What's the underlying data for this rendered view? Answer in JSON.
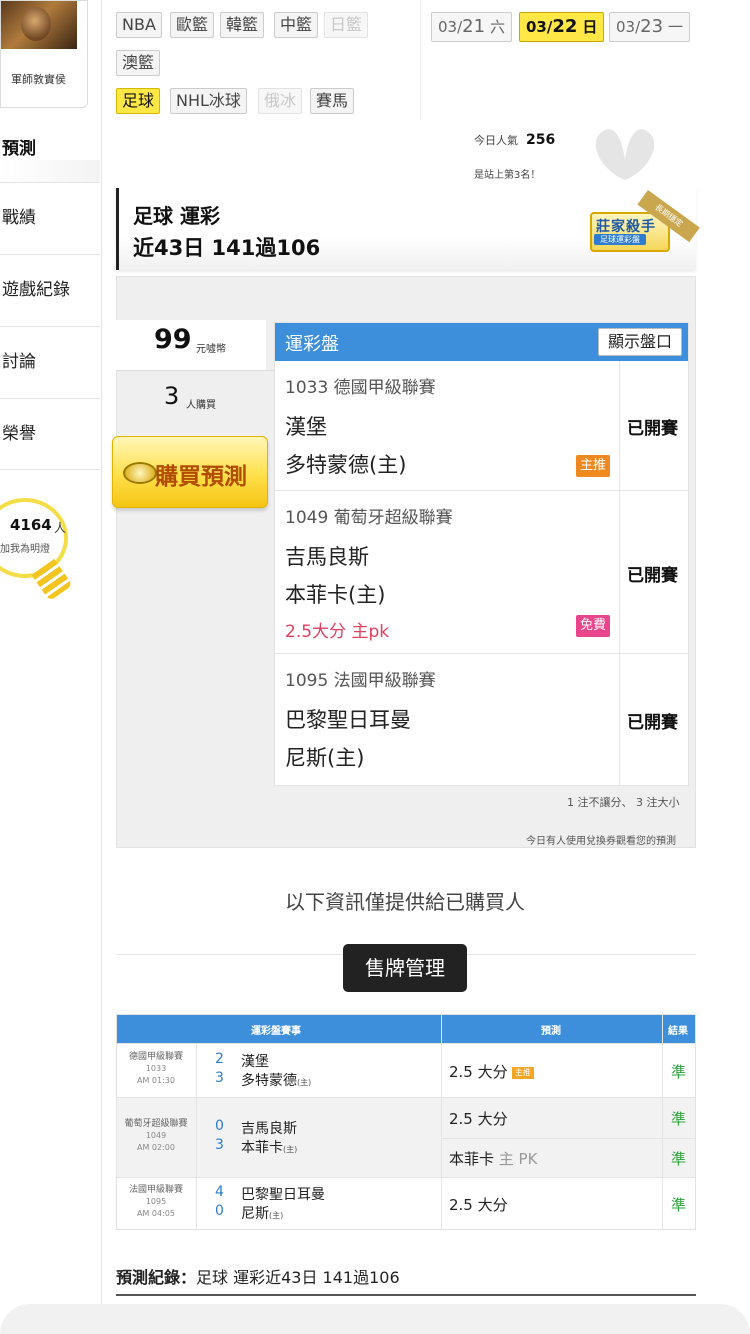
{
  "profile": {
    "name": "軍師敦實侯"
  },
  "left_nav": {
    "section_title": "預測",
    "items": [
      "戰績",
      "遊戲紀錄",
      "討論",
      "榮譽"
    ],
    "fans": {
      "count": "4164",
      "unit": "人",
      "join": "加我為明燈"
    }
  },
  "categories": [
    {
      "label": "NBA",
      "state": "normal"
    },
    {
      "label": "歐籃",
      "state": "normal"
    },
    {
      "label": "韓籃",
      "state": "normal"
    },
    {
      "label": "中籃",
      "state": "normal"
    },
    {
      "label": "日籃",
      "state": "disabled"
    },
    {
      "label": "澳籃",
      "state": "normal"
    },
    {
      "label": "足球",
      "state": "active"
    },
    {
      "label": "NHL冰球",
      "state": "normal"
    },
    {
      "label": "俄冰",
      "state": "disabled"
    },
    {
      "label": "賽馬",
      "state": "normal"
    }
  ],
  "dates": [
    {
      "prefix": "03/",
      "day": "21",
      "weekday": "六",
      "active": false
    },
    {
      "prefix": "03/",
      "day": "22",
      "weekday": "日",
      "active": true
    },
    {
      "prefix": "03/",
      "day": "23",
      "weekday": "一",
      "active": false
    }
  ],
  "popularity": {
    "label": "今日人氣",
    "value": "256",
    "rank_text": "是站上第3名！"
  },
  "title": {
    "line1": "足球 運彩",
    "line2": "近43日 141過106"
  },
  "badge": {
    "title": "莊家殺手",
    "subtitle": "足球運彩盤",
    "ribbon": "長期穩定"
  },
  "price": {
    "value": "99",
    "unit": "元噓幣"
  },
  "buyers": {
    "value": "3",
    "unit": "人購買"
  },
  "buy_button": {
    "label": "購買預測"
  },
  "plate": {
    "title": "運彩盤",
    "show_button": "顯示盤口",
    "games": [
      {
        "league": "1033 德國甲級聯賽",
        "team1": "漢堡",
        "team2": "多特蒙德(主)",
        "pick": "",
        "tag": "主推",
        "tag_type": "main",
        "status": "已開賽"
      },
      {
        "league": "1049 葡萄牙超級聯賽",
        "team1": "吉馬良斯",
        "team2": "本菲卡(主)",
        "pick": "2.5大分 主pk",
        "tag": "免費",
        "tag_type": "free",
        "status": "已開賽"
      },
      {
        "league": "1095 法國甲級聯賽",
        "team1": "巴黎聖日耳曼",
        "team2": "尼斯(主)",
        "pick": "",
        "tag": "",
        "tag_type": "",
        "status": "已開賽"
      }
    ],
    "note1": "1 注不讓分、 3 注大小",
    "note2": "今日有人使用兌換券觀看您的預測"
  },
  "info": {
    "buyers_only": "以下資訊僅提供給已購買人",
    "sell_button": "售牌管理"
  },
  "table": {
    "headers": [
      "運彩盤賽事",
      "預測",
      "結果"
    ],
    "rows": [
      {
        "league": "德國甲級聯賽",
        "code": "1033",
        "time": "AM 01:30",
        "score1": "2",
        "team1": "漢堡",
        "score2": "3",
        "team2": "多特蒙德",
        "home": "(主)",
        "picks": [
          {
            "text": "2.5 大分",
            "tag": "主推",
            "muted": "",
            "result": "準"
          }
        ]
      },
      {
        "league": "葡萄牙超級聯賽",
        "code": "1049",
        "time": "AM 02:00",
        "score1": "0",
        "team1": "吉馬良斯",
        "score2": "3",
        "team2": "本菲卡",
        "home": "(主)",
        "picks": [
          {
            "text": "2.5 大分",
            "tag": "",
            "muted": "",
            "result": "準"
          },
          {
            "text": "本菲卡",
            "tag": "",
            "muted": " 主 PK",
            "result": "準"
          }
        ]
      },
      {
        "league": "法國甲級聯賽",
        "code": "1095",
        "time": "AM 04:05",
        "score1": "4",
        "team1": "巴黎聖日耳曼",
        "score2": "0",
        "team2": "尼斯",
        "home": "(主)",
        "picks": [
          {
            "text": "2.5 大分",
            "tag": "",
            "muted": "",
            "result": "準"
          }
        ]
      }
    ]
  },
  "record": {
    "label": "預測紀錄：",
    "text": "足球 運彩近43日 141過106"
  },
  "colors": {
    "accent_blue": "#3d8fdb",
    "active_yellow": "#ffe845",
    "result_green": "#2aa23a",
    "pick_pink": "#e04060"
  }
}
